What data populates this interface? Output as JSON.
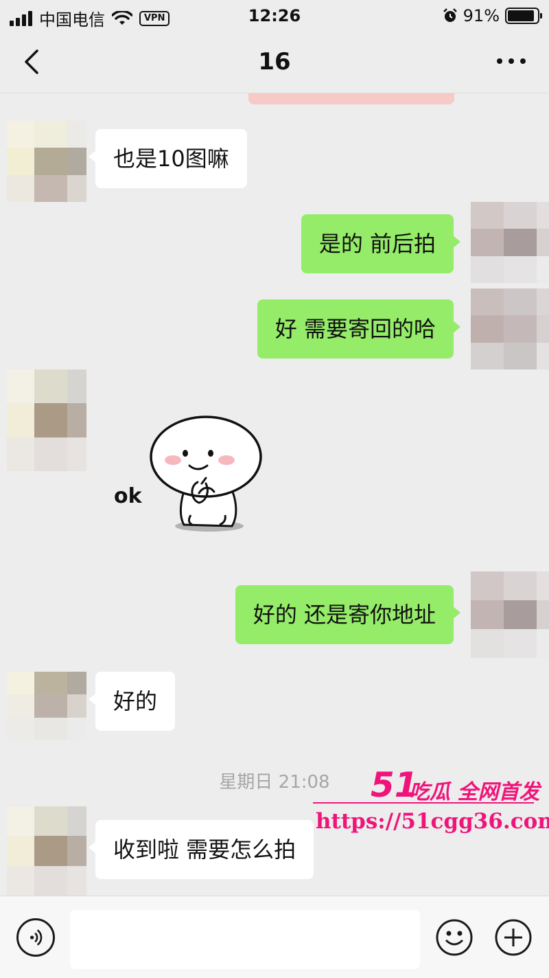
{
  "status_bar": {
    "carrier": "中国电信",
    "vpn": "VPN",
    "time": "12:26",
    "battery": "91%",
    "battery_level": 0.91
  },
  "nav": {
    "title": "16"
  },
  "messages": [
    {
      "side": "in",
      "text": "也是10图嘛"
    },
    {
      "side": "out",
      "text": "是的 前后拍"
    },
    {
      "side": "out",
      "text": "好 需要寄回的哈"
    },
    {
      "side": "in",
      "type": "sticker",
      "sticker_text": "ok"
    },
    {
      "side": "out",
      "text": "好的 还是寄你地址"
    },
    {
      "side": "in",
      "text": "好的"
    },
    {
      "side": "in",
      "text": "收到啦 需要怎么拍"
    }
  ],
  "timestamp": "星期日 21:08",
  "watermark": {
    "number": "51",
    "tagline": "吃瓜 全网首发",
    "url": "https://51cgg36.com"
  },
  "input_bar": {
    "value": ""
  }
}
